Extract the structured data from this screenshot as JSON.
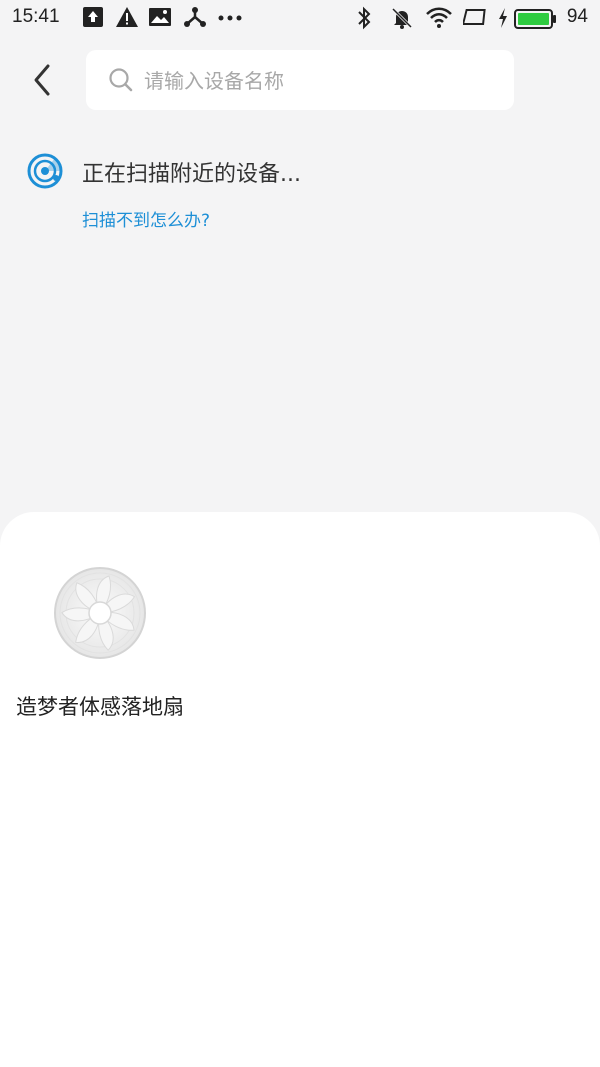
{
  "status_bar": {
    "time": "15:41",
    "battery_level": "94",
    "icons": [
      "upload-icon",
      "warning-icon",
      "image-icon",
      "share-icon",
      "more-icon",
      "bluetooth-icon",
      "mute-icon",
      "wifi-icon",
      "screen-icon",
      "charging-icon",
      "battery-icon"
    ]
  },
  "header": {
    "back_icon": "chevron-left-icon",
    "search_placeholder": "请输入设备名称",
    "search_value": ""
  },
  "scan": {
    "icon": "scan-radar-icon",
    "status": "正在扫描附近的设备...",
    "help_link": "扫描不到怎么办?"
  },
  "devices": [
    {
      "icon": "fan-icon",
      "name": "造梦者体感落地扇"
    }
  ],
  "colors": {
    "accent": "#1d8fd6",
    "background": "#f4f4f5",
    "panel": "#ffffff",
    "battery": "#2ecc40"
  }
}
